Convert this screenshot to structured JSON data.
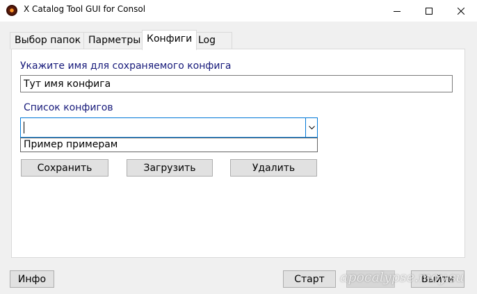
{
  "window": {
    "title": "X Catalog Tool GUI for Consol"
  },
  "tabs": [
    {
      "label": "Выбор папок"
    },
    {
      "label": "Парметры"
    },
    {
      "label": "Конфиги"
    },
    {
      "label": "Log"
    }
  ],
  "configs": {
    "name_label": "Укажите имя для сохраняемого конфига",
    "name_value": "Тут имя конфига",
    "list_label": "Список конфигов",
    "combo_value": "",
    "dropdown_items": [
      "Пример примерам"
    ],
    "save_label": "Сохранить",
    "load_label": "Загрузить",
    "delete_label": "Удалить"
  },
  "footer": {
    "info_label": "Инфо",
    "start_label": "Старт",
    "exit_label": "Выйти"
  },
  "watermark": "apocalypse.moy.su"
}
